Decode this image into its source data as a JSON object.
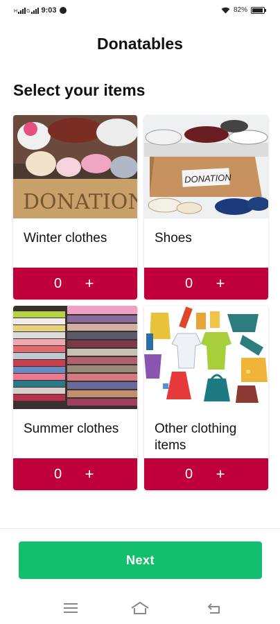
{
  "status_bar": {
    "time": "9:03",
    "network_label_1": "H",
    "network_label_2": "G",
    "battery": "82%",
    "icons": [
      "signal-icon",
      "data-saver-icon",
      "wifi-icon",
      "battery-icon"
    ]
  },
  "header": {
    "title": "Donatables"
  },
  "section": {
    "title": "Select your items"
  },
  "items": [
    {
      "label": "Winter clothes",
      "quantity": "0",
      "plus": "+",
      "image": "winter-clothes-photo"
    },
    {
      "label": "Shoes",
      "quantity": "0",
      "plus": "+",
      "image": "shoes-donation-photo"
    },
    {
      "label": "Summer clothes",
      "quantity": "0",
      "plus": "+",
      "image": "summer-clothes-photo"
    },
    {
      "label": "Other clothing items",
      "quantity": "0",
      "plus": "+",
      "image": "clothing-illustration"
    }
  ],
  "footer": {
    "next_label": "Next"
  },
  "nav": [
    "menu-icon",
    "home-icon",
    "back-icon"
  ],
  "colors": {
    "accent": "#c0003a",
    "primary_button": "#13bf6d"
  }
}
